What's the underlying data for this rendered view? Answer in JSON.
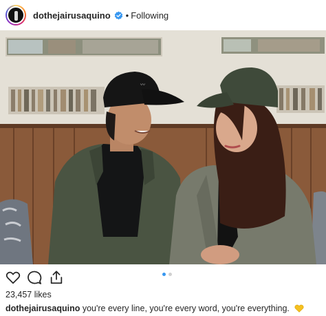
{
  "post": {
    "username": "dothejairusaquino",
    "follow_status": "Following",
    "verified": true,
    "likes": "23,457 likes",
    "caption": "you're every line, you're every word, you're everything.",
    "caption_emoji": "yellow-heart-icon",
    "carousel": {
      "count": 2,
      "active_index": 0
    }
  },
  "icons": {
    "verified": "verified-badge-icon",
    "like": "heart-outline-icon",
    "comment": "comment-bubble-icon",
    "share": "share-upload-icon"
  },
  "colors": {
    "verified_badge": "#3897f0",
    "carousel_active": "#3897f0",
    "emoji_heart": "#f5c020",
    "text": "#262626"
  },
  "photo": {
    "description": "couple-in-caps-photo"
  }
}
